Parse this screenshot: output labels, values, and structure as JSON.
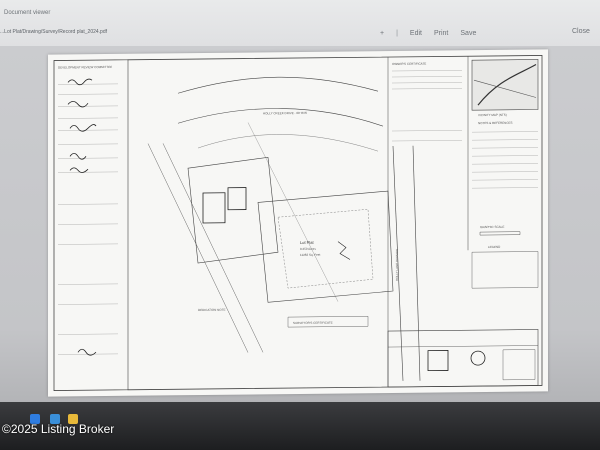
{
  "browser": {
    "tab_text": "Document viewer",
    "address_text": "...Lot Plat/Drawing/Survey/Record plat_2024.pdf",
    "toolbar": {
      "zoom_in": "+",
      "divider": "|",
      "edit_label": "Edit",
      "print_label": "Print",
      "save_label": "Save",
      "close_label": "Close"
    }
  },
  "document": {
    "approval_block_title": "DEVELOPMENT REVIEW COMMITTEE",
    "owner_cert_title": "OWNER'S CERTIFICATE",
    "vicinity_map_title": "VICINITY MAP (NTS)",
    "notes_title": "NOTES & REFERENCES",
    "lot_label": "Lot Plat",
    "lot_area": "0.259 Acres",
    "lot_sqft": "11282 Sq. Feet",
    "surveyor_cert_title": "SURVEYOR'S CERTIFICATE",
    "dedication_label": "DEDICATION NOTE",
    "road_label": "HOLLY CREEK DRIVE - 60' R/W",
    "side_road_label": "HOLLY LANE DIVISION",
    "legend_title": "LEGEND",
    "graphic_scale_title": "GRAPHIC SCALE"
  },
  "watermark": {
    "text": "©2025 Listing Broker"
  },
  "colors": {
    "screen_bg": "#cfd0d2",
    "paper": "#f7f7f5",
    "ink": "#333333",
    "watermark_text": "#ffffff"
  }
}
